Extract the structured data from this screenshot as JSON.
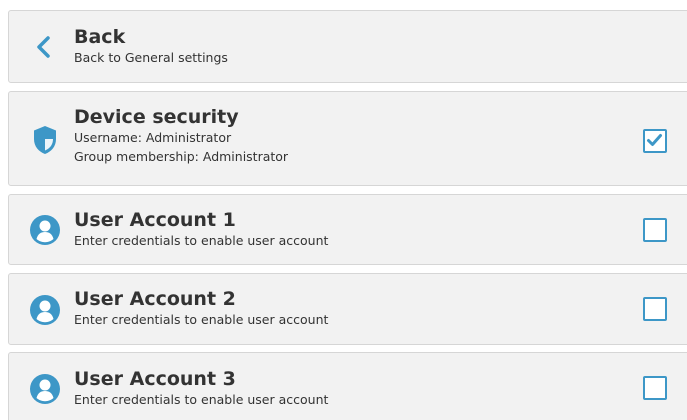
{
  "back": {
    "icon": "chevron-left-icon",
    "title": "Back",
    "subtitle": "Back to General settings"
  },
  "device_security": {
    "icon": "shield-icon",
    "title": "Device security",
    "line1": "Username: Administrator",
    "line2": "Group membership: Administrator",
    "checked": true
  },
  "accounts": [
    {
      "icon": "user-icon",
      "title": "User Account 1",
      "subtitle": "Enter credentials to enable user account",
      "checked": false
    },
    {
      "icon": "user-icon",
      "title": "User Account 2",
      "subtitle": "Enter credentials to enable user account",
      "checked": false
    },
    {
      "icon": "user-icon",
      "title": "User Account 3",
      "subtitle": "Enter credentials to enable user account",
      "checked": false
    }
  ],
  "colors": {
    "accent": "#3d97c7",
    "card_background": "#f2f2f2",
    "text": "#333333"
  }
}
